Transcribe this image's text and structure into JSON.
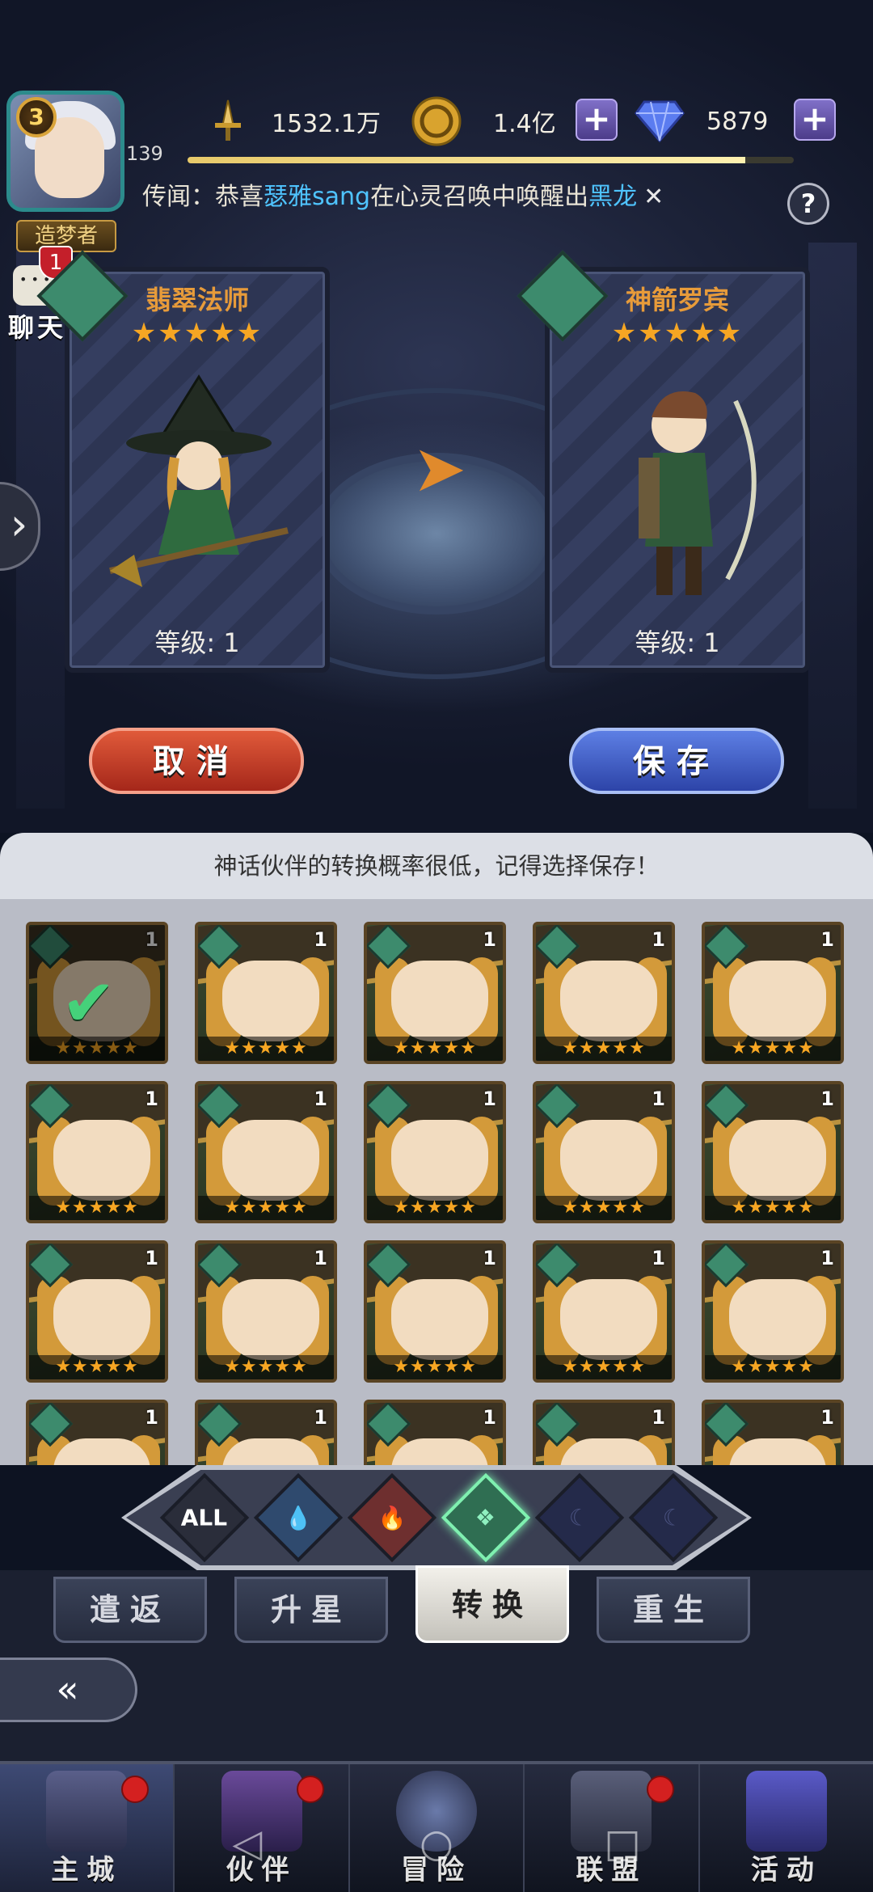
{
  "header": {
    "player_level": "3",
    "player_title": "造梦者",
    "exp_level": "139",
    "xp_fraction": 0.92,
    "power": "1532.1万",
    "gold": "1.4亿",
    "diamonds": "5879",
    "plus": "+",
    "help": "?"
  },
  "news": {
    "prefix": "传闻：恭喜",
    "player": "瑟雅sang",
    "middle": "在心灵召唤中唤醒出",
    "item": "黑龙",
    "close": "✕"
  },
  "chat": {
    "label": "聊天",
    "badge": "1"
  },
  "left_card": {
    "name": "翡翠法师",
    "stars": "★★★★★",
    "level": "等级: 1"
  },
  "right_card": {
    "name": "神箭罗宾",
    "stars": "★★★★★",
    "level": "等级: 1"
  },
  "buttons": {
    "cancel": "取消",
    "save": "保存"
  },
  "tip": "神话伙伴的转换概率很低，记得选择保存！",
  "grid": {
    "tile_level": "1",
    "tile_stars": "★★★★★"
  },
  "filters": [
    {
      "name": "ALL",
      "color": "#2a2d3a"
    },
    {
      "name": "water",
      "color": "#2f4a6e"
    },
    {
      "name": "fire",
      "color": "#6e2f2f"
    },
    {
      "name": "wind",
      "color": "#2f6e52"
    },
    {
      "name": "dark",
      "color": "#242a4a"
    },
    {
      "name": "dark2",
      "color": "#242a4a"
    }
  ],
  "subtabs": [
    "遣返",
    "升星",
    "转换",
    "重生"
  ],
  "active_subtab": "转换",
  "nav": [
    "主城",
    "伙伴",
    "冒险",
    "联盟",
    "活动"
  ],
  "colors": {
    "accent_orange": "#f6a623",
    "highlight_blue": "#4fc4ff",
    "cancel_red": "#c0392b",
    "save_blue": "#3451c2"
  }
}
